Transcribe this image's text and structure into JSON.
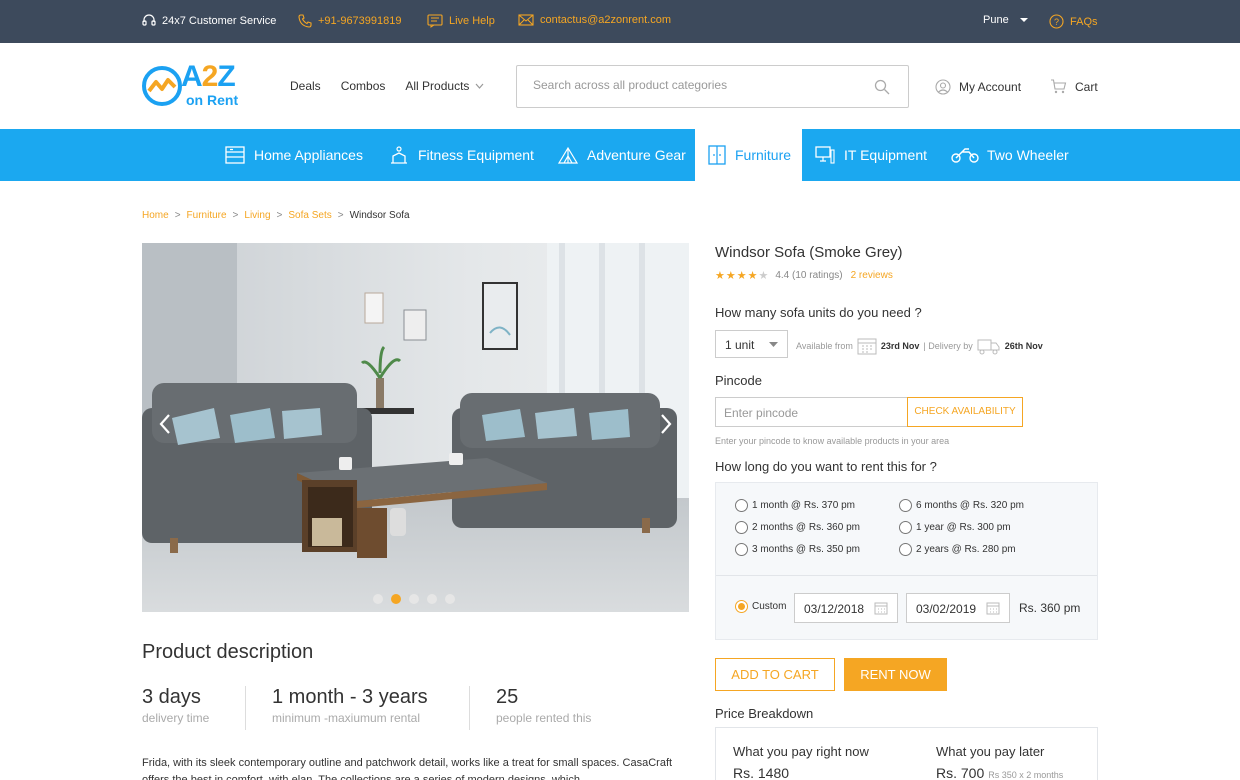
{
  "topbar": {
    "service": "24x7 Customer Service",
    "phone": "+91-9673991819",
    "live_help": "Live Help",
    "email": "contactus@a2zonrent.com",
    "city": "Pune",
    "faqs": "FAQs"
  },
  "header": {
    "logo_a": "A",
    "logo_two": "2",
    "logo_z": "Z",
    "logo_sub": "on Rent",
    "nav": {
      "deals": "Deals",
      "combos": "Combos",
      "all_products": "All Products"
    },
    "search_placeholder": "Search across all product categories",
    "account": "My Account",
    "cart": "Cart"
  },
  "categories": [
    {
      "label": "Home Appliances",
      "icon": "fridge-icon"
    },
    {
      "label": "Fitness Equipment",
      "icon": "fitness-icon"
    },
    {
      "label": "Adventure Gear",
      "icon": "tent-icon"
    },
    {
      "label": "Furniture",
      "icon": "cupboard-icon",
      "active": true
    },
    {
      "label": "IT Equipment",
      "icon": "computer-icon"
    },
    {
      "label": "Two Wheeler",
      "icon": "scooter-icon"
    }
  ],
  "breadcrumb": {
    "items": [
      "Home",
      "Furniture",
      "Living",
      "Sofa Sets"
    ],
    "current": "Windsor Sofa"
  },
  "gallery": {
    "slide_count": 5,
    "active_slide": 2
  },
  "description": {
    "title": "Product description",
    "stats": [
      {
        "value": "3 days",
        "label": "delivery time"
      },
      {
        "value": "1 month - 3 years",
        "label": "minimum -maxiumum rental"
      },
      {
        "value": "25",
        "label": "people rented this"
      }
    ],
    "text": "Frida, with its sleek contemporary outline and patchwork detail, works like a treat for small spaces. CasaCraft offers the best in comfort, with elan. The collections are a series of modern designs, which"
  },
  "product": {
    "title": "Windsor Sofa (Smoke Grey)",
    "rating_text": "4.4 (10 ratings)",
    "rating_value": 4.4,
    "reviews": "2 reviews",
    "units_question": "How many sofa units do you need ?",
    "unit_value": "1 unit",
    "available_label": "Available from",
    "available_date": "23rd Nov",
    "delivery_label": "| Delivery by",
    "delivery_date": "26th Nov",
    "pincode_label": "Pincode",
    "pincode_placeholder": "Enter pincode",
    "check_label": "CHECK AVAILABILITY",
    "pincode_hint": "Enter your pincode to know available products in your area",
    "rent_question": "How long do you want to rent this for ?",
    "rent_options": [
      "1 month @ Rs. 370 pm",
      "2 months @ Rs. 360 pm",
      "3 months @ Rs. 350 pm",
      "6 months @ Rs. 320 pm",
      "1 year @ Rs. 300 pm",
      "2 years @ Rs. 280 pm"
    ],
    "custom_label": "Custom",
    "custom_from": "03/12/2018",
    "custom_to": "03/02/2019",
    "custom_price": "Rs. 360 pm",
    "add_to_cart": "ADD TO CART",
    "rent_now": "RENT NOW",
    "price_breakdown_title": "Price Breakdown",
    "pay_now_label": "What you pay right now",
    "pay_now_value": "Rs. 1480",
    "pay_later_label": "What you pay later",
    "pay_later_value": "Rs. 700",
    "pay_later_note": "Rs 350 x 2 months"
  },
  "colors": {
    "brand_blue": "#1ba1f2",
    "accent_orange": "#f5a623",
    "topbar": "#3d4a5c"
  }
}
